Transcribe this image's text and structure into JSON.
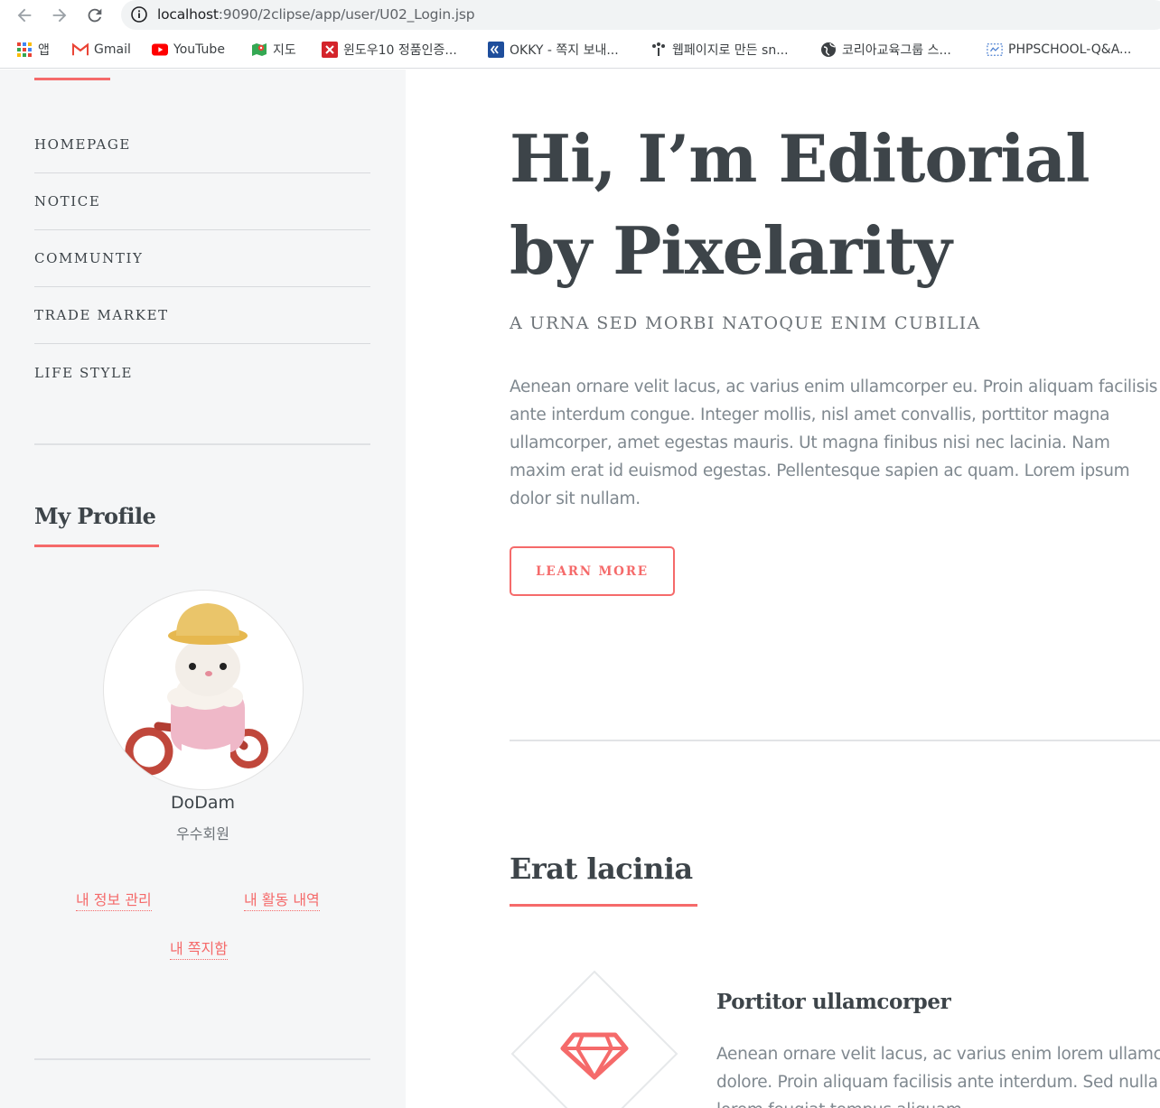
{
  "browser": {
    "url_host": "localhost",
    "url_path": ":9090/2clipse/app/user/U02_Login.jsp",
    "bookmarks": [
      {
        "label": "앱",
        "icon": "apps-grid-icon"
      },
      {
        "label": "Gmail",
        "icon": "gmail-icon"
      },
      {
        "label": "YouTube",
        "icon": "youtube-icon"
      },
      {
        "label": "지도",
        "icon": "maps-icon"
      },
      {
        "label": "윈도우10 정품인증...",
        "icon": "windows-activation-icon"
      },
      {
        "label": "OKKY - 쪽지 보내...",
        "icon": "okky-icon"
      },
      {
        "label": "웹페이지로 만든 sn...",
        "icon": "dots-icon"
      },
      {
        "label": "코리아교육그룹 스...",
        "icon": "globe-icon"
      },
      {
        "label": "PHPSCHOOL-Q&A...",
        "icon": "phpschool-icon"
      }
    ]
  },
  "sidebar": {
    "menu": [
      "HOMEPAGE",
      "NOTICE",
      "COMMUNTIY",
      "TRADE MARKET",
      "LIFE STYLE"
    ],
    "profile": {
      "title": "My Profile",
      "username": "DoDam",
      "grade": "우수회원",
      "links": {
        "info": "내 정보 관리",
        "activity": "내 활동 내역",
        "messages": "내 쪽지함"
      }
    }
  },
  "main": {
    "headline_line1": "Hi, I’m Editorial",
    "headline_line2": "by Pixelarity",
    "subheading": "A URNA SED MORBI NATOQUE ENIM CUBILIA",
    "paragraph": "Aenean ornare velit lacus, ac varius enim ullamcorper eu. Proin aliquam facilisis ante interdum congue. Integer mollis, nisl amet convallis, porttitor magna ullamcorper, amet egestas mauris. Ut magna finibus nisi nec lacinia. Nam maxim erat id euismod egestas. Pellentesque sapien ac quam. Lorem ipsum dolor sit nullam.",
    "button": "LEARN MORE",
    "section_title": "Erat lacinia",
    "feature": {
      "icon": "diamond-icon",
      "title": "Portitor ullamcorper",
      "line1": "Aenean ornare velit lacus, ac varius enim lorem ullamco",
      "line2": "dolore. Proin aliquam facilisis ante interdum. Sed nulla",
      "line3": "lorem feugiat tempus aliquam."
    }
  },
  "colors": {
    "accent": "#f56a6a",
    "sidebar_bg": "#f5f6f7",
    "heading": "#3d4449",
    "body_text": "#7f888f"
  }
}
